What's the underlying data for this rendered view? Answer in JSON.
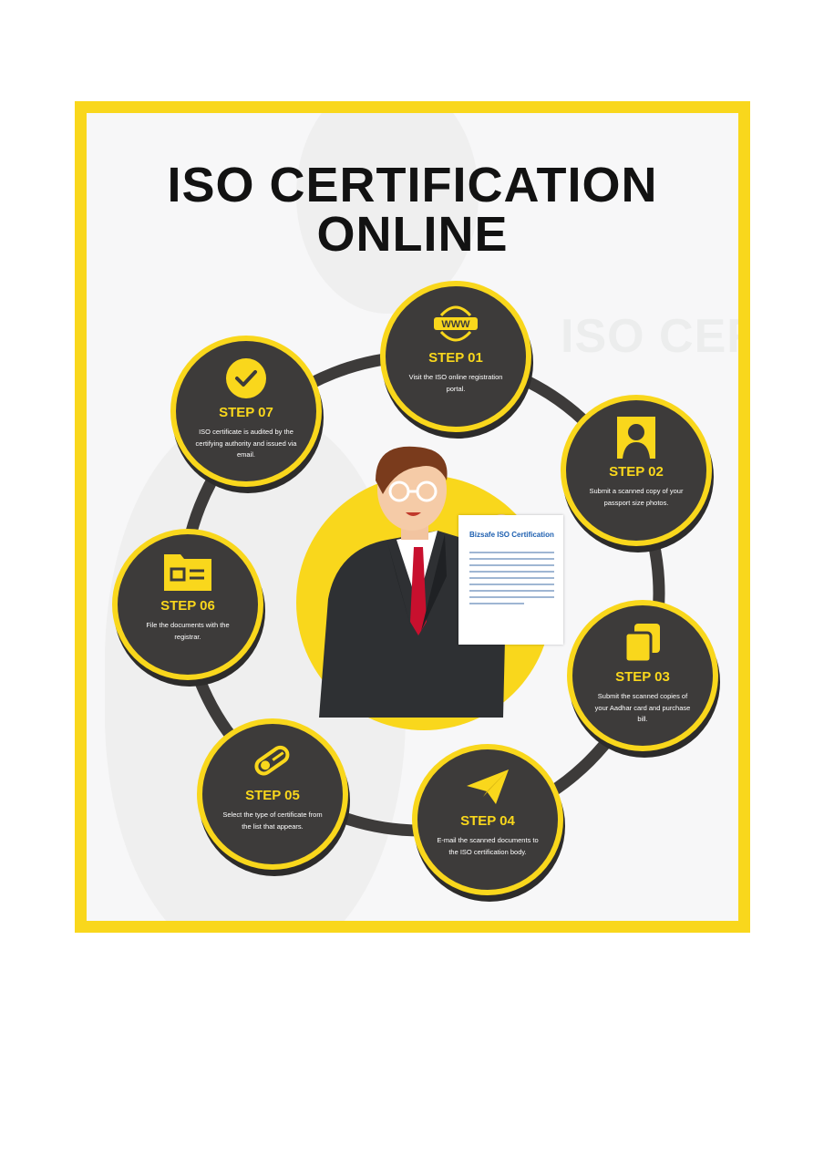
{
  "title": {
    "line1": "ISO CERTIFICATION",
    "line2": "ONLINE"
  },
  "background_text": "ISO CERT",
  "document": {
    "title": "Bizsafe ISO Certification"
  },
  "steps": [
    {
      "label": "STEP 01",
      "icon": "www-globe-icon",
      "desc": "Visit the ISO online registration portal."
    },
    {
      "label": "STEP 02",
      "icon": "person-photo-icon",
      "desc": "Submit a scanned copy of your passport size photos."
    },
    {
      "label": "STEP 03",
      "icon": "copy-documents-icon",
      "desc": "Submit the scanned copies of your Aadhar card and purchase bill."
    },
    {
      "label": "STEP 04",
      "icon": "paper-plane-icon",
      "desc": "E-mail the scanned documents to the ISO certification body."
    },
    {
      "label": "STEP 05",
      "icon": "certificate-scroll-icon",
      "desc": "Select the type of certificate from the list that appears."
    },
    {
      "label": "STEP 06",
      "icon": "folder-icon",
      "desc": "File the documents with the registrar."
    },
    {
      "label": "STEP 07",
      "icon": "check-circle-icon",
      "desc": "ISO certificate is audited by the certifying authority and issued via email."
    }
  ],
  "colors": {
    "accent": "#f9d71c",
    "circle": "#3d3b3a",
    "text": "#121212"
  }
}
